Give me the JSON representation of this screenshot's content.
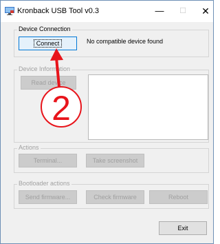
{
  "window": {
    "title": "Kronback USB Tool v0.3",
    "minimize_glyph": "—",
    "maximize_glyph": "☐",
    "close_glyph": "✕",
    "app_icon": "usb-app-icon"
  },
  "device_connection": {
    "group_label": "Device Connection",
    "connect_label": "Connect",
    "status_text": "No compatible device found"
  },
  "device_information": {
    "group_label": "Device Information",
    "read_label": "Read device"
  },
  "actions": {
    "group_label": "Actions",
    "terminal_label": "Terminal...",
    "screenshot_label": "Take screenshot"
  },
  "bootloader": {
    "group_label": "Bootloader actions",
    "send_firmware_label": "Send firmware...",
    "check_firmware_label": "Check firmware",
    "reboot_label": "Reboot"
  },
  "footer": {
    "exit_label": "Exit"
  },
  "annotation": {
    "step_number": "2",
    "color": "#e8141b"
  }
}
